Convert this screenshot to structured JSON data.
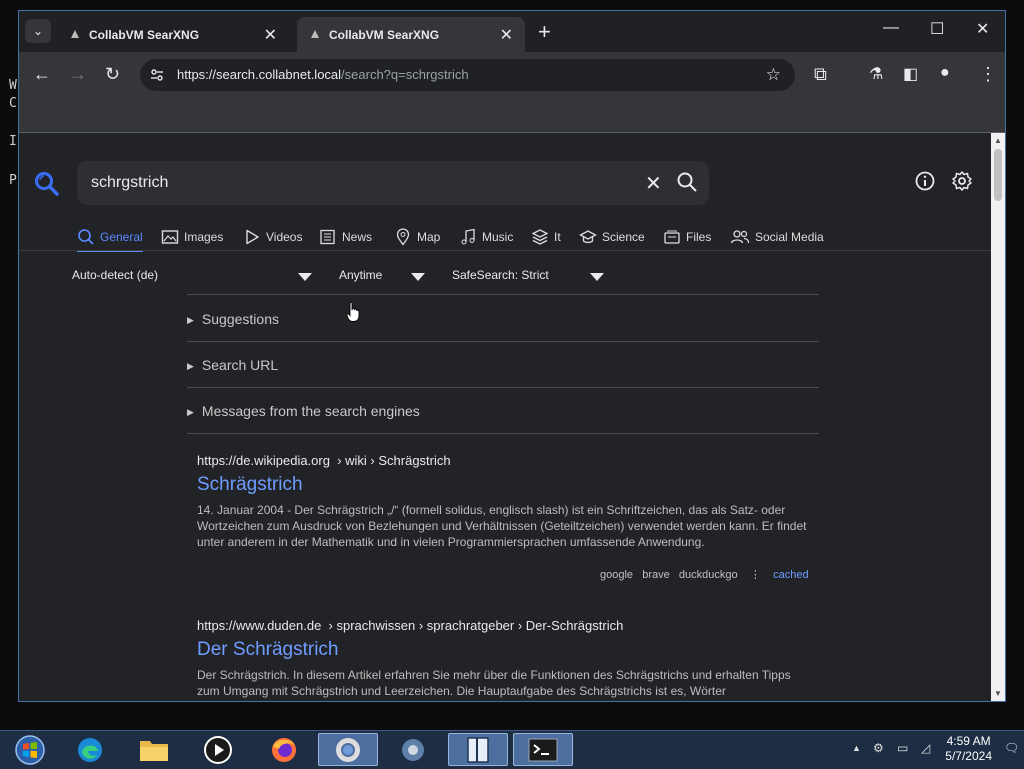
{
  "desktop": {
    "bg_text": [
      "W",
      "C",
      "I",
      "P"
    ]
  },
  "browser": {
    "tabs": [
      {
        "title": "CollabVM SearXNG",
        "active": false
      },
      {
        "title": "CollabVM SearXNG",
        "active": true
      }
    ],
    "new_tab": "+",
    "window_controls": {
      "minimize": "—",
      "maximize": "☐",
      "close": "✕"
    },
    "address_host": "https://search.collabnet.local",
    "address_path": "/search?q=schrgstrich"
  },
  "search": {
    "query": "schrgstrich",
    "categories": [
      {
        "label": "General",
        "icon": "search-icon",
        "active": true
      },
      {
        "label": "Images",
        "icon": "image-icon"
      },
      {
        "label": "Videos",
        "icon": "play-icon"
      },
      {
        "label": "News",
        "icon": "newspaper-icon"
      },
      {
        "label": "Map",
        "icon": "map-pin-icon"
      },
      {
        "label": "Music",
        "icon": "music-note-icon"
      },
      {
        "label": "It",
        "icon": "layers-icon"
      },
      {
        "label": "Science",
        "icon": "school-icon"
      },
      {
        "label": "Files",
        "icon": "files-icon"
      },
      {
        "label": "Social Media",
        "icon": "people-icon"
      }
    ],
    "filters": {
      "language": "Auto-detect (de)",
      "time": "Anytime",
      "safesearch": "SafeSearch: Strict"
    },
    "details": [
      "Suggestions",
      "Search URL",
      "Messages from the search engines"
    ],
    "results": [
      {
        "url": "https://de.wikipedia.org",
        "path": "› wiki › Schrägstrich",
        "title": "Schrägstrich",
        "snippet": "14. Januar 2004 - Der Schrägstrich „/“ (formell solidus, englisch slash) ist ein Schriftzeichen, das als Satz- oder Wortzeichen zum Ausdruck von Bezlehungen und Verhältnissen (Geteiltzeichen) verwendet werden kann. Er findet unter anderem in der Mathematik und in vielen Programmiersprachen umfassende Anwendung.",
        "engines": [
          "google",
          "brave",
          "duckduckgo"
        ],
        "cached": "cached"
      },
      {
        "url": "https://www.duden.de",
        "path": "› sprachwissen › sprachratgeber › Der-Schrägstrich",
        "title": "Der Schrägstrich",
        "snippet": "Der Schrägstrich. In diesem Artikel erfahren Sie mehr über die Funktionen des Schrägstrichs und erhalten Tipps zum Umgang mit Schrägstrich und Leerzeichen. Die Hauptaufgabe des Schrägstrichs ist es, Wörter"
      }
    ]
  },
  "taskbar": {
    "time": "4:59 AM",
    "date": "5/7/2024"
  },
  "colors": {
    "accent": "#5c8aff",
    "link": "#6f9dff",
    "taskbar": "#1c2d44"
  }
}
